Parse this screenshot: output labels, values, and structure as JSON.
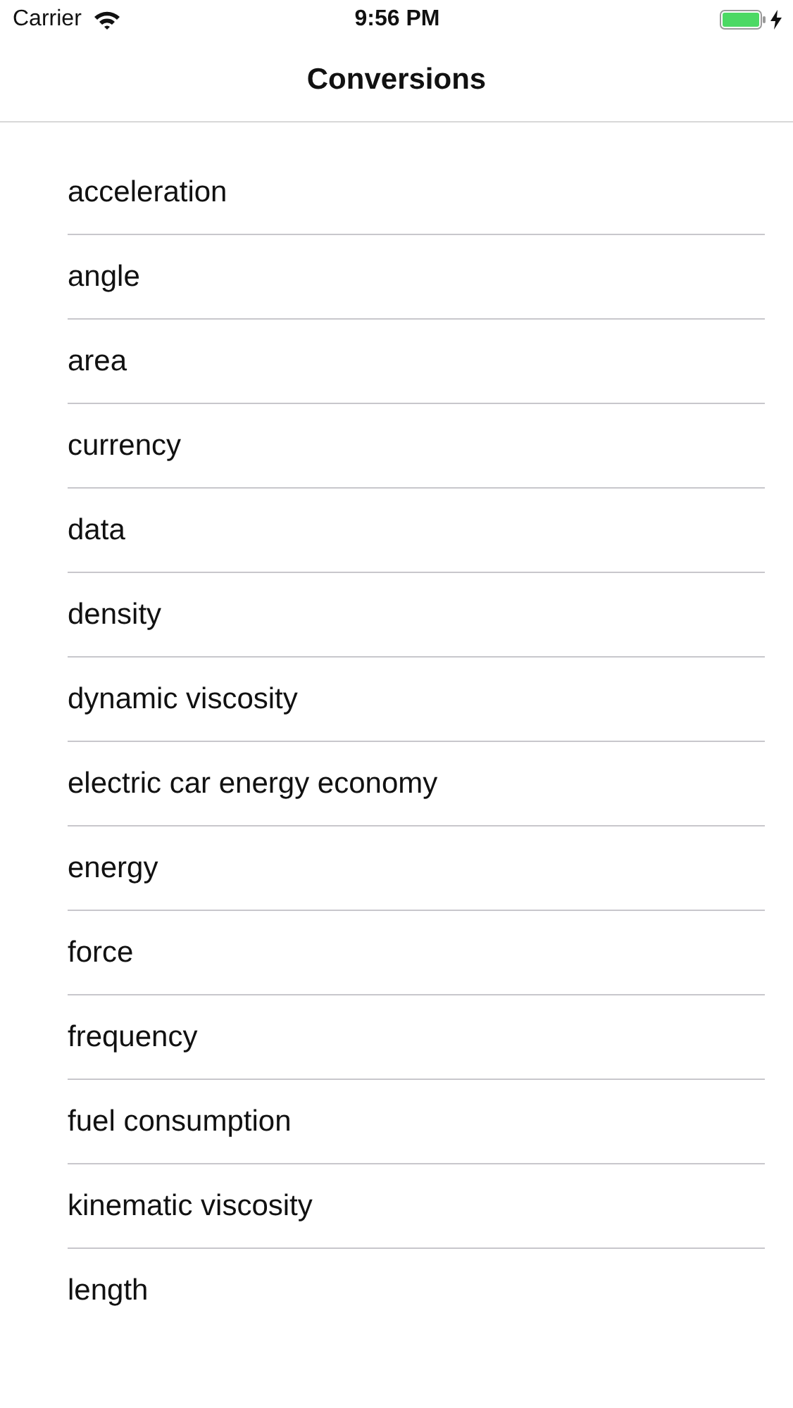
{
  "status_bar": {
    "carrier": "Carrier",
    "time": "9:56 PM"
  },
  "nav_bar": {
    "title": "Conversions"
  },
  "items": [
    {
      "label": "acceleration"
    },
    {
      "label": "angle"
    },
    {
      "label": "area"
    },
    {
      "label": "currency"
    },
    {
      "label": "data"
    },
    {
      "label": "density"
    },
    {
      "label": "dynamic viscosity"
    },
    {
      "label": "electric car energy economy"
    },
    {
      "label": "energy"
    },
    {
      "label": "force"
    },
    {
      "label": "frequency"
    },
    {
      "label": "fuel consumption"
    },
    {
      "label": "kinematic viscosity"
    },
    {
      "label": "length"
    }
  ]
}
